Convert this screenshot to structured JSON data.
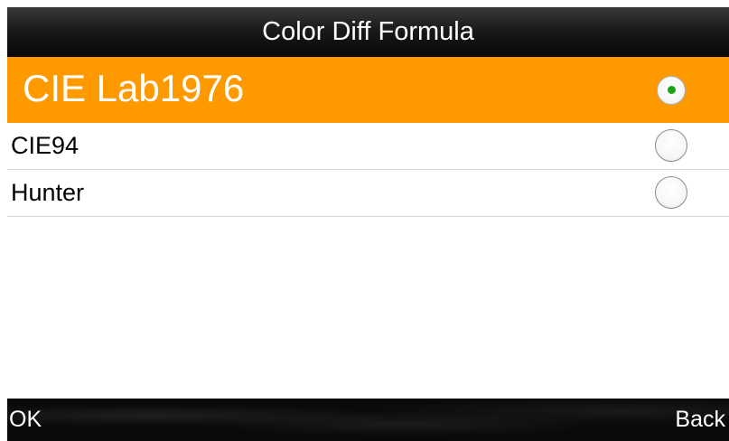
{
  "title": "Color Diff Formula",
  "options": [
    {
      "label": "CIE Lab1976",
      "selected": true
    },
    {
      "label": "CIE94",
      "selected": false
    },
    {
      "label": "Hunter",
      "selected": false
    }
  ],
  "softkeys": {
    "left_label": "OK",
    "right_label": "Back"
  },
  "colors": {
    "selected_row": "#ff9900",
    "radio_dot": "#19a319",
    "title_bar": "#1a1a1a",
    "bottom_bar": "#0a0a0a"
  },
  "icons": {
    "radio_on": "radio-selected-icon",
    "radio_off": "radio-unselected-icon"
  }
}
